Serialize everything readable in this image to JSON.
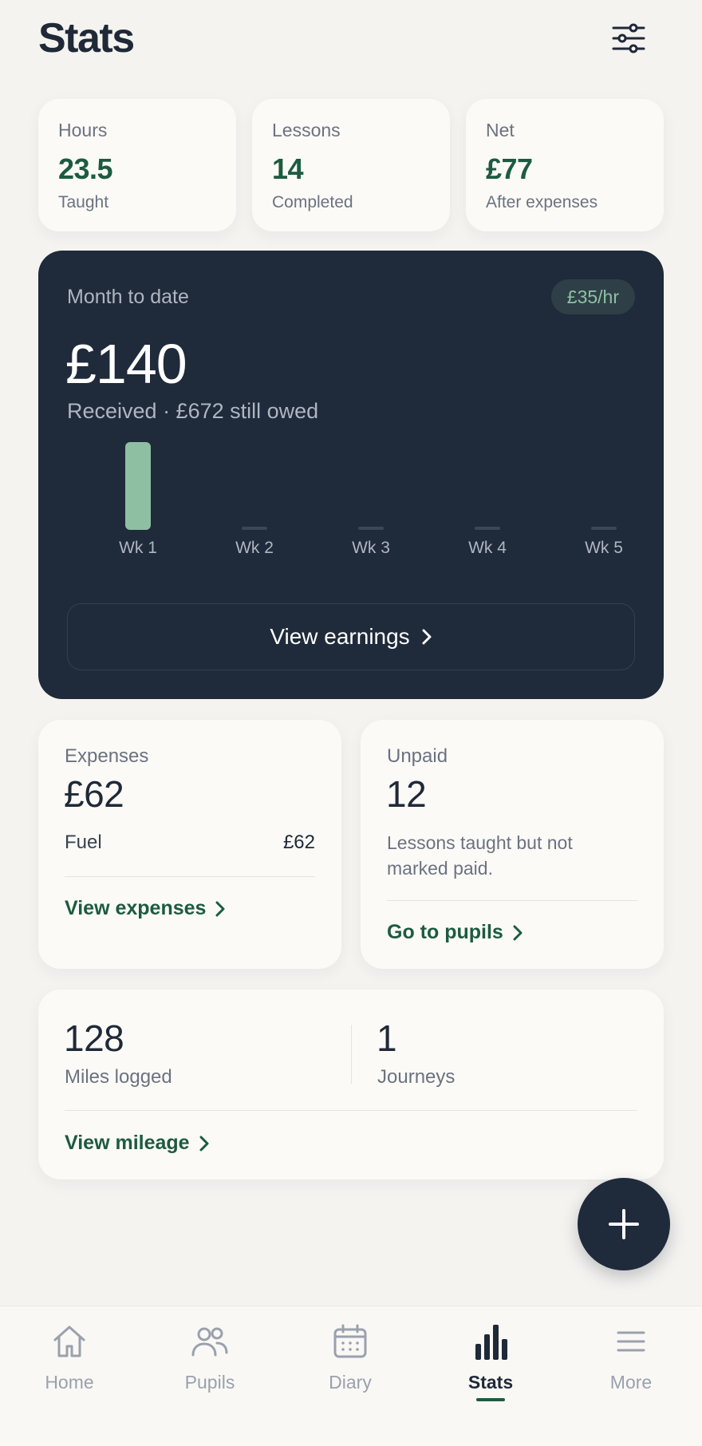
{
  "header": {
    "title": "Stats",
    "filter_icon": "sliders-icon"
  },
  "kpis": [
    {
      "label": "Hours",
      "value": "23.5",
      "sub": "Taught"
    },
    {
      "label": "Lessons",
      "value": "14",
      "sub": "Completed"
    },
    {
      "label": "Net",
      "value": "£77",
      "sub": "After expenses"
    }
  ],
  "month": {
    "label": "Month to date",
    "rate_badge": "£35/hr",
    "amount": "£140",
    "sub": "Received · £672 still owed",
    "button_label": "View earnings"
  },
  "chart_data": {
    "type": "bar",
    "categories": [
      "Wk 1",
      "Wk 2",
      "Wk 3",
      "Wk 4",
      "Wk 5"
    ],
    "values": [
      140,
      0,
      0,
      0,
      0
    ],
    "ylim": [
      0,
      140
    ],
    "grid": false,
    "bar_color": "#8fbfa3",
    "empty_color": "#3b4758"
  },
  "expenses": {
    "label": "Expenses",
    "amount": "£62",
    "line_label": "Fuel",
    "line_value": "£62",
    "link_label": "View expenses"
  },
  "unpaid": {
    "label": "Unpaid",
    "count": "12",
    "desc_line1": "Lessons taught but not",
    "desc_line2": "marked paid.",
    "link_label": "Go to pupils"
  },
  "mileage": {
    "miles_value": "128",
    "miles_label": "Miles logged",
    "journeys_value": "1",
    "journeys_label": "Journeys",
    "link_label": "View mileage"
  },
  "fab": {
    "icon": "plus-icon"
  },
  "tabbar": {
    "items": [
      {
        "label": "Home",
        "icon": "home-icon",
        "active": false
      },
      {
        "label": "Pupils",
        "icon": "users-icon",
        "active": false
      },
      {
        "label": "Diary",
        "icon": "calendar-icon",
        "active": false
      },
      {
        "label": "Stats",
        "icon": "bar-chart-icon",
        "active": true
      },
      {
        "label": "More",
        "icon": "menu-icon",
        "active": false
      }
    ]
  },
  "colors": {
    "brand_green": "#1d5b3f",
    "navy": "#1f2a3a",
    "background": "#f4f3f0",
    "card": "#fbfaf7"
  }
}
